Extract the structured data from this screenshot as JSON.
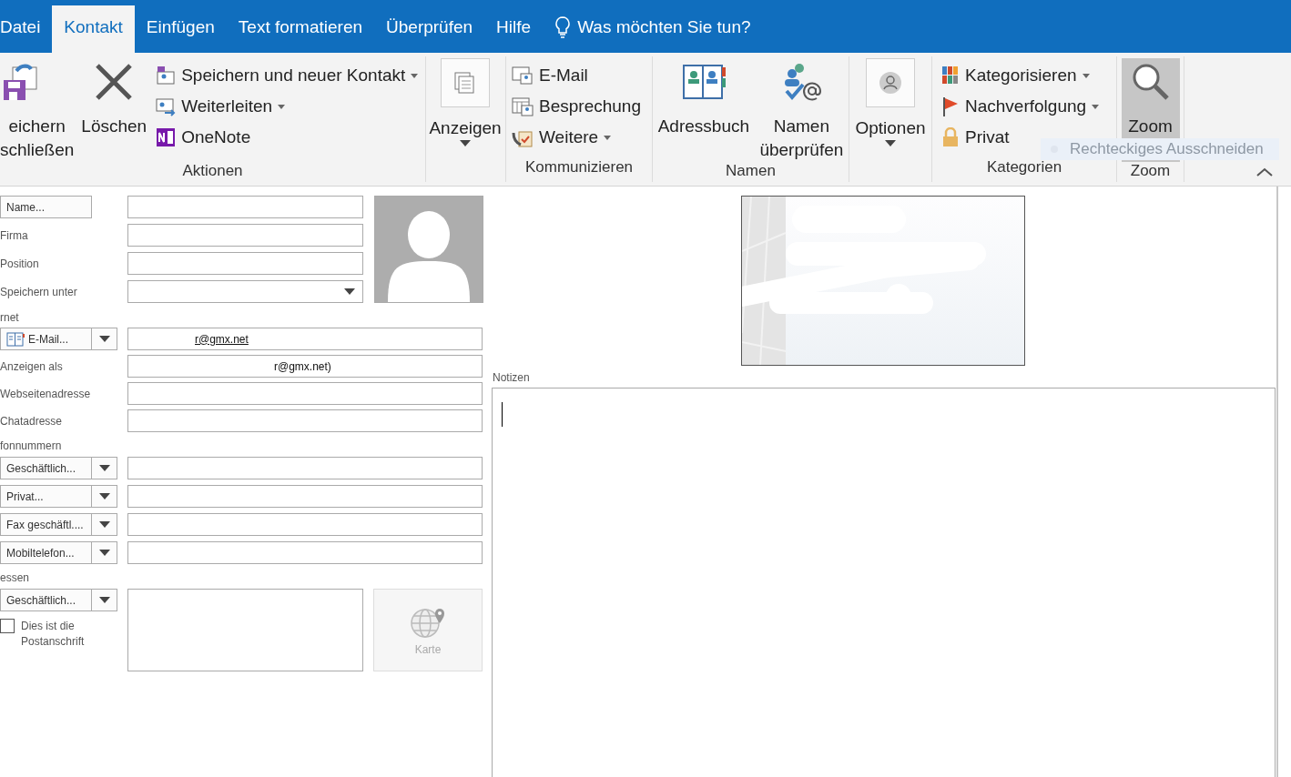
{
  "tabs": [
    {
      "label": "Datei",
      "selected": false
    },
    {
      "label": "Kontakt",
      "selected": true
    },
    {
      "label": "Einfügen",
      "selected": false
    },
    {
      "label": "Text formatieren",
      "selected": false
    },
    {
      "label": "Überprüfen",
      "selected": false
    },
    {
      "label": "Hilfe",
      "selected": false
    }
  ],
  "tell_me": "Was möchten Sie tun?",
  "ribbon": {
    "aktionen": {
      "label": "Aktionen",
      "save_close": [
        "eichern",
        "schließen"
      ],
      "delete": "Löschen",
      "save_new": "Speichern und neuer Kontakt",
      "forward": "Weiterleiten",
      "onenote": "OneNote"
    },
    "anzeigen": {
      "button": "Anzeigen"
    },
    "kommunizieren": {
      "label": "Kommunizieren",
      "email": "E-Mail",
      "meeting": "Besprechung",
      "more": "Weitere"
    },
    "namen": {
      "label": "Namen",
      "address_book": "Adressbuch",
      "check_names": [
        "Namen",
        "überprüfen"
      ]
    },
    "optionen": {
      "button": "Optionen"
    },
    "kategorien": {
      "label": "Kategorien",
      "categorize": "Kategorisieren",
      "follow_up": "Nachverfolgung",
      "private": "Privat"
    },
    "zoom": {
      "label": "Zoom",
      "button": "Zoom",
      "highlighted": true
    }
  },
  "snip_hint": "Rechteckiges Ausschneiden",
  "form": {
    "name_button": "Name...",
    "fields": [
      {
        "label": "Firma"
      },
      {
        "label": "Position"
      }
    ],
    "save_as": {
      "label": "Speichern unter"
    },
    "internet_heading": "rnet",
    "email": {
      "button": "E-Mail...",
      "value": "r@gmx.net"
    },
    "contact_fields": [
      {
        "label": "Anzeigen als",
        "value": "r@gmx.net)"
      },
      {
        "label": "Webseitenadresse"
      },
      {
        "label": "Chatadresse"
      }
    ],
    "phone_heading": "fonnummern",
    "phones": [
      {
        "button": "Geschäftlich..."
      },
      {
        "button": "Privat..."
      },
      {
        "button": "Fax geschäftl...."
      },
      {
        "button": "Mobiltelefon..."
      }
    ],
    "address_heading": "essen",
    "address": {
      "button": "Geschäftlich...",
      "mailing_label": "Dies ist die Postanschrift",
      "mailing_checked": false,
      "map_button": "Karte"
    }
  },
  "notes_label": "Notizen"
}
